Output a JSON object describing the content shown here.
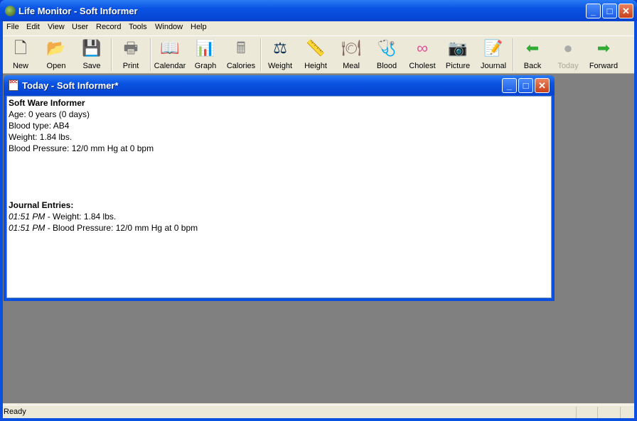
{
  "window": {
    "title": "Life Monitor - Soft Informer"
  },
  "menu": [
    "File",
    "Edit",
    "View",
    "User",
    "Record",
    "Tools",
    "Window",
    "Help"
  ],
  "toolbar": [
    {
      "label": "New",
      "icon": "new-document-icon",
      "glyph": "🗋",
      "color": "#333"
    },
    {
      "label": "Open",
      "icon": "open-folder-icon",
      "glyph": "📂",
      "color": "#b90"
    },
    {
      "label": "Save",
      "icon": "save-disk-icon",
      "glyph": "💾",
      "color": "#333"
    },
    {
      "sep": true
    },
    {
      "label": "Print",
      "icon": "printer-icon",
      "glyph": "🖶",
      "color": "#777"
    },
    {
      "sep": true
    },
    {
      "label": "Calendar",
      "icon": "calendar-book-icon",
      "glyph": "📖",
      "color": "#a60"
    },
    {
      "label": "Graph",
      "icon": "bar-graph-icon",
      "glyph": "📊",
      "color": "#c0c"
    },
    {
      "label": "Calories",
      "icon": "calculator-icon",
      "glyph": "🖩",
      "color": "#888"
    },
    {
      "sep": true
    },
    {
      "label": "Weight",
      "icon": "scale-icon",
      "glyph": "⚖",
      "color": "#135"
    },
    {
      "label": "Height",
      "icon": "ruler-icon",
      "glyph": "📏",
      "color": "#cb0"
    },
    {
      "label": "Meal",
      "icon": "meal-plate-icon",
      "glyph": "🍽",
      "color": "#866"
    },
    {
      "label": "Blood",
      "icon": "blood-pressure-cuff-icon",
      "glyph": "🩺",
      "color": "#064"
    },
    {
      "label": "Cholest",
      "icon": "cholesterol-icon",
      "glyph": "∞",
      "color": "#e0509a"
    },
    {
      "label": "Picture",
      "icon": "camera-icon",
      "glyph": "📷",
      "color": "#000"
    },
    {
      "label": "Journal",
      "icon": "journal-pencil-icon",
      "glyph": "📝",
      "color": "#33c"
    },
    {
      "sep": true
    },
    {
      "label": "Back",
      "icon": "back-arrow-icon",
      "glyph": "⬅",
      "color": "#3a3"
    },
    {
      "label": "Today",
      "icon": "today-icon",
      "glyph": "●",
      "color": "#aaa",
      "disabled": true
    },
    {
      "label": "Forward",
      "icon": "forward-arrow-icon",
      "glyph": "➡",
      "color": "#3a3"
    }
  ],
  "child": {
    "title": "Today - Soft Informer*",
    "icon_text": "DOC",
    "name": "Soft Ware Informer",
    "lines": [
      "Age: 0 years (0 days)",
      "Blood type: AB4",
      "Weight: 1.84 lbs.",
      "Blood Pressure: 12/0 mm Hg at 0 bpm"
    ],
    "journal_heading": "Journal Entries:",
    "entries": [
      {
        "time": "01:51 PM",
        "text": " - Weight: 1.84 lbs."
      },
      {
        "time": "01:51 PM",
        "text": " - Blood Pressure: 12/0 mm Hg at 0 bpm"
      }
    ]
  },
  "status": {
    "text": "Ready"
  },
  "caption": {
    "minimize": "_",
    "maximize": "□",
    "close": "✕"
  }
}
